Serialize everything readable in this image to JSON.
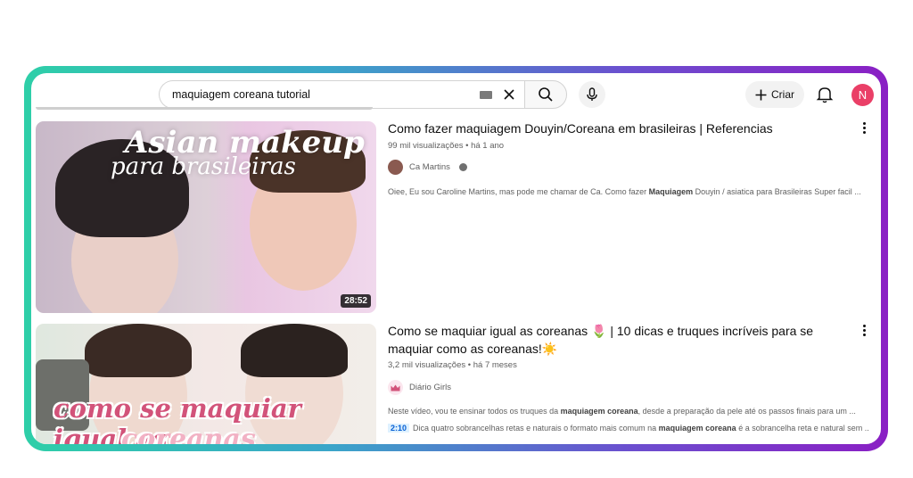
{
  "search": {
    "query": "maquiagem coreana tutorial"
  },
  "header": {
    "create_label": "Criar",
    "avatar_initial": "N"
  },
  "results": [
    {
      "title": "Como fazer maquiagem Douyin/Coreana em brasileiras | Referencias",
      "views": "99 mil visualizações",
      "age": "há 1 ano",
      "meta_sep": "•",
      "channel": "Ca Martins",
      "description_pre": "Oiee, Eu sou Caroline Martins, mas pode me chamar de Ca. Como fazer ",
      "description_bold": "Maquiagem",
      "description_post": " Douyin / asiatica para Brasileiras Super facil ...",
      "duration": "28:52",
      "thumb_text_1": "Asian makeup",
      "thumb_text_2": "para brasileiras"
    },
    {
      "title": "Como se maquiar igual as coreanas 🌷 | 10 dicas e truques incríveis para se maquiar como as coreanas!☀️",
      "views": "3,2 mil visualizações",
      "age": "há 7 meses",
      "meta_sep": "•",
      "channel": "Diário Girls",
      "description_pre": "Neste vídeo, vou te ensinar todos os truques da ",
      "description_bold": "maquiagem coreana",
      "description_post": ", desde a preparação da pele até os passos finais para um ...",
      "chapter_time": "2:10",
      "chapter_pre": "Dica quatro sobrancelhas retas e naturais o formato mais comum na ",
      "chapter_bold": "maquiagem coreana",
      "chapter_post": " é a sobrancelha reta e natural sem ...",
      "thumb_text_1": "como se maquiar igual as",
      "thumb_text_2": "coreanas"
    }
  ],
  "colors": {
    "frame_start": "#2ecfa8",
    "frame_end": "#8a1fc4",
    "avatar": "#ea3f67",
    "chapter_link": "#065fd4"
  }
}
